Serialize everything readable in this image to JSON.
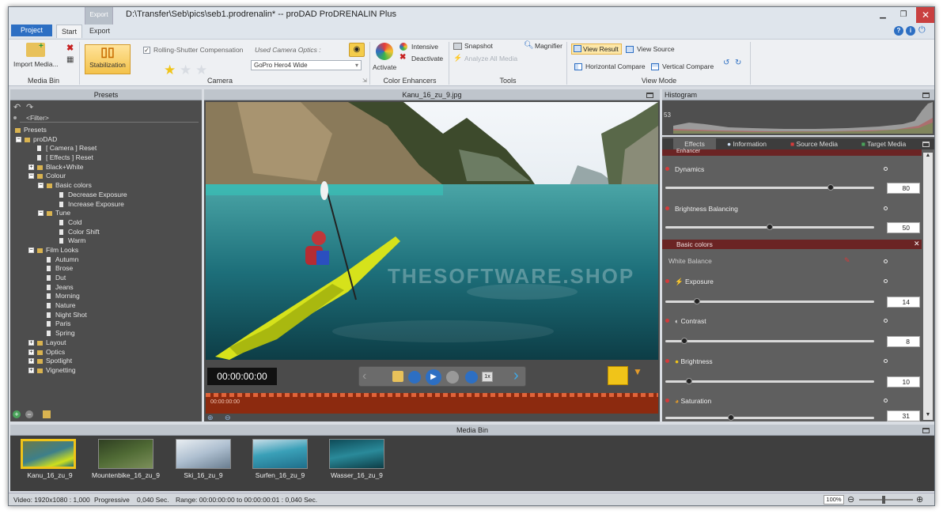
{
  "window": {
    "title": "D:\\Transfer\\Seb\\pics\\seb1.prodrenalin* -- proDAD ProDRENALIN Plus",
    "context_tab": "Export"
  },
  "tabs": {
    "project": "Project",
    "start": "Start",
    "export": "Export"
  },
  "ribbon": {
    "media_bin": {
      "import_label": "Import Media...",
      "group_label": "Media Bin"
    },
    "camera": {
      "stabilization_label": "Stabilization",
      "rolling_shutter_label": "Rolling-Shutter Compensation",
      "used_optics_label": "Used Camera Optics :",
      "optics_value": "GoPro Hero4 Wide",
      "group_label": "Camera"
    },
    "color_enhancers": {
      "activate_label": "Activate",
      "intensive_label": "Intensive",
      "deactivate_label": "Deactivate",
      "group_label": "Color Enhancers"
    },
    "tools": {
      "snapshot_label": "Snapshot",
      "magnifier_label": "Magnifier",
      "analyze_label": "Analyze All Media",
      "group_label": "Tools"
    },
    "view_mode": {
      "view_result_label": "View Result",
      "view_source_label": "View Source",
      "horizontal_compare_label": "Horizontal Compare",
      "vertical_compare_label": "Vertical Compare",
      "group_label": "View Mode"
    }
  },
  "presets": {
    "title": "Presets",
    "filter_placeholder": "<Filter>",
    "tree": [
      {
        "label": "Presets",
        "level": 0,
        "kind": "root"
      },
      {
        "label": "proDAD",
        "level": 1,
        "kind": "folder-open"
      },
      {
        "label": "[ Camera ] Reset",
        "level": 2,
        "kind": "doc"
      },
      {
        "label": "[ Effects ] Reset",
        "level": 2,
        "kind": "doc"
      },
      {
        "label": "Black+White",
        "level": 2,
        "kind": "folder"
      },
      {
        "label": "Colour",
        "level": 2,
        "kind": "folder-open"
      },
      {
        "label": "Basic colors",
        "level": 3,
        "kind": "folder-open"
      },
      {
        "label": "Decrease Exposure",
        "level": 4,
        "kind": "doc"
      },
      {
        "label": "Increase Exposure",
        "level": 4,
        "kind": "doc"
      },
      {
        "label": "Tune",
        "level": 3,
        "kind": "folder-open"
      },
      {
        "label": "Cold",
        "level": 4,
        "kind": "doc"
      },
      {
        "label": "Color Shift",
        "level": 4,
        "kind": "doc"
      },
      {
        "label": "Warm",
        "level": 4,
        "kind": "doc"
      },
      {
        "label": "Film Looks",
        "level": 2,
        "kind": "folder-open"
      },
      {
        "label": "Autumn",
        "level": 3,
        "kind": "doc"
      },
      {
        "label": "Brose",
        "level": 3,
        "kind": "doc"
      },
      {
        "label": "Dut",
        "level": 3,
        "kind": "doc"
      },
      {
        "label": "Jeans",
        "level": 3,
        "kind": "doc"
      },
      {
        "label": "Morning",
        "level": 3,
        "kind": "doc"
      },
      {
        "label": "Nature",
        "level": 3,
        "kind": "doc"
      },
      {
        "label": "Night Shot",
        "level": 3,
        "kind": "doc"
      },
      {
        "label": "Paris",
        "level": 3,
        "kind": "doc"
      },
      {
        "label": "Spring",
        "level": 3,
        "kind": "doc"
      },
      {
        "label": "Layout",
        "level": 2,
        "kind": "folder"
      },
      {
        "label": "Optics",
        "level": 2,
        "kind": "folder"
      },
      {
        "label": "Spotlight",
        "level": 2,
        "kind": "folder"
      },
      {
        "label": "Vignetting",
        "level": 2,
        "kind": "folder"
      }
    ]
  },
  "preview": {
    "file_name": "Kanu_16_zu_9.jpg",
    "timecode": "00:00:00:00",
    "timeline_timecode": "00:00:00:00",
    "watermark": "THESOFTWARE.SHOP",
    "speed_badge": "1x"
  },
  "histogram": {
    "title": "Histogram",
    "value": "53"
  },
  "effects": {
    "tabs": [
      "Effects",
      "Information",
      "Source Media",
      "Target Media"
    ],
    "enhancer_header": "Enhancer",
    "basic_colors_header": "Basic colors",
    "white_balance_label": "White Balance",
    "params": [
      {
        "label": "Dynamics",
        "value": "80",
        "level": 0.8
      },
      {
        "label": "Brightness Balancing",
        "value": "50",
        "level": 0.5
      },
      {
        "label": "Exposure",
        "value": "14",
        "level": 0.14
      },
      {
        "label": "Contrast",
        "value": "8",
        "level": 0.08
      },
      {
        "label": "Brightness",
        "value": "10",
        "level": 0.1
      },
      {
        "label": "Saturation",
        "value": "31",
        "level": 0.31
      }
    ]
  },
  "media_bin": {
    "title": "Media Bin",
    "items": [
      {
        "label": "Kanu_16_zu_9",
        "selected": true
      },
      {
        "label": "Mountenbike_16_zu_9",
        "selected": false
      },
      {
        "label": "Ski_16_zu_9",
        "selected": false
      },
      {
        "label": "Surfen_16_zu_9",
        "selected": false
      },
      {
        "label": "Wasser_16_zu_9",
        "selected": false
      }
    ]
  },
  "status": {
    "video_info": "Video: 1920x1080 : 1,000",
    "scan": "Progressive",
    "duration": "0,040 Sec.",
    "range": "Range: 00:00:00:00 to 00:00:00:01 : 0,040 Sec.",
    "zoom": "100%"
  },
  "colors": {
    "accent_blue": "#2d6fc3",
    "highlight_yellow": "#f0c419",
    "effect_header_red": "#6b2424",
    "timeline_red": "#8c2a0f"
  }
}
